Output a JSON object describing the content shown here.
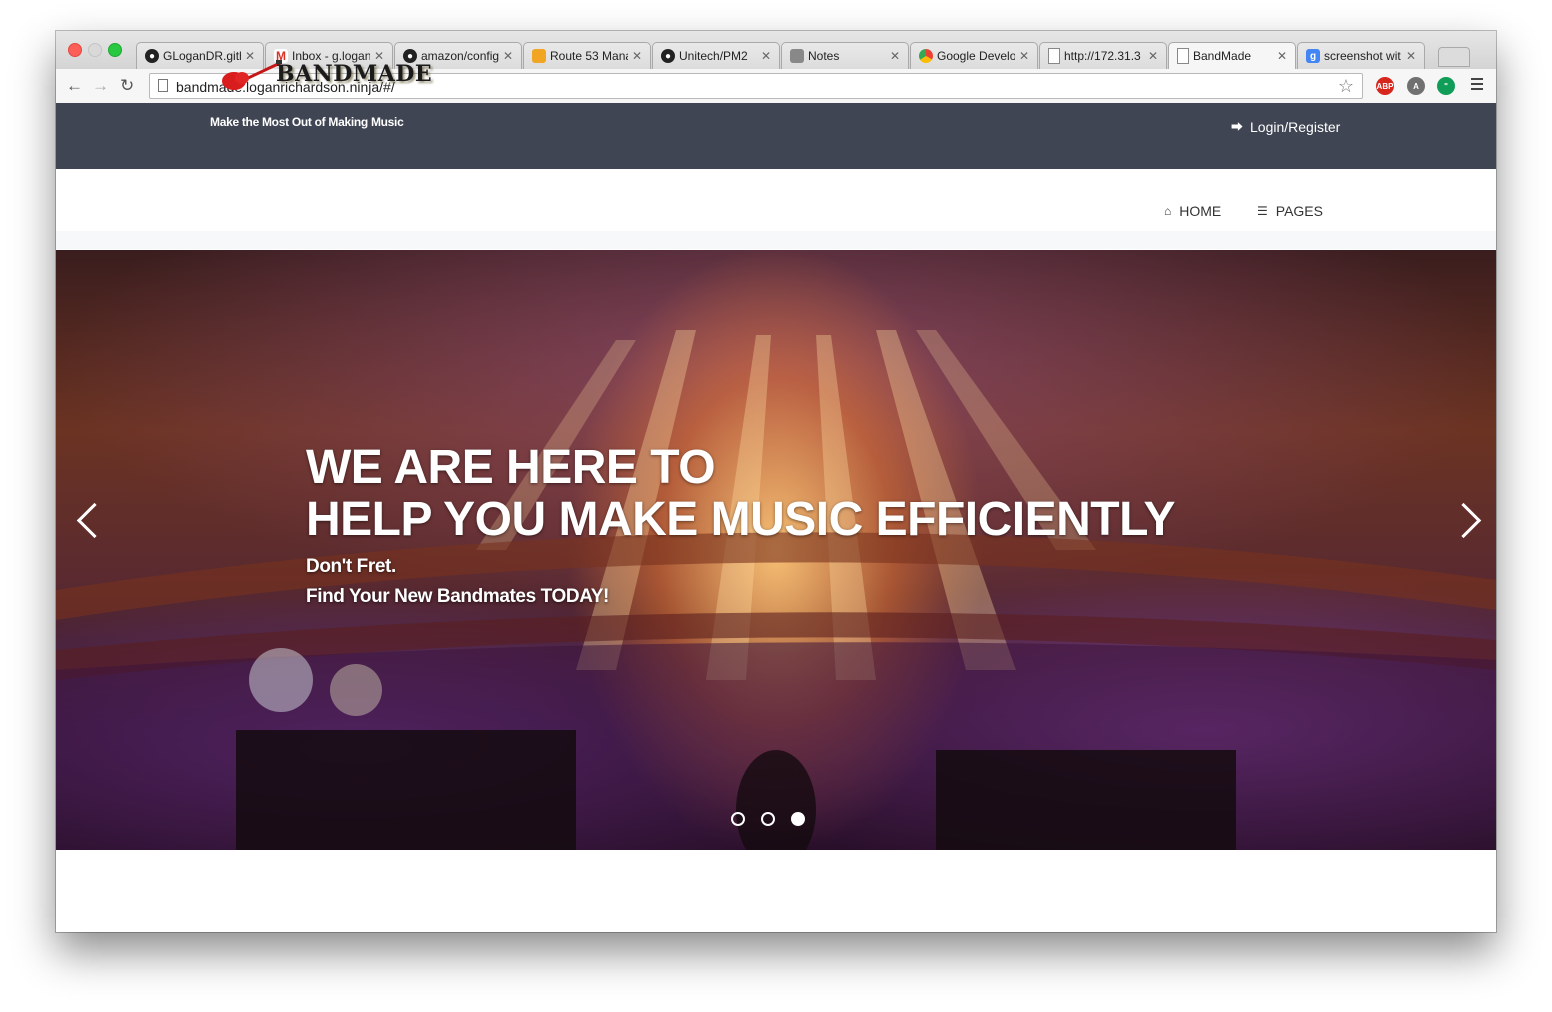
{
  "browser": {
    "tabs": [
      {
        "title": "GLoganDR.gith",
        "favicon": "github-icon"
      },
      {
        "title": "Inbox - g.logan",
        "favicon": "gmail-icon"
      },
      {
        "title": "amazon/config",
        "favicon": "github-icon"
      },
      {
        "title": "Route 53 Mana",
        "favicon": "aws-icon"
      },
      {
        "title": "Unitech/PM2",
        "favicon": "github-icon"
      },
      {
        "title": "Notes",
        "favicon": "notes-icon"
      },
      {
        "title": "Google Develo",
        "favicon": "chrome-icon"
      },
      {
        "title": "http://172.31.3",
        "favicon": "page-icon"
      },
      {
        "title": "BandMade",
        "favicon": "page-icon",
        "active": true
      },
      {
        "title": "screenshot wit",
        "favicon": "google-icon"
      }
    ],
    "url": "bandmade.loganrichardson.ninja/#/",
    "extensions": [
      "adblock-icon",
      "angular-icon",
      "hangouts-icon"
    ]
  },
  "site": {
    "tagline": "Make the Most Out of Making Music",
    "login_label": "Login/Register",
    "logo_text": "BANDMADE",
    "nav": {
      "home": "HOME",
      "pages": "PAGES"
    },
    "hero": {
      "line1": "WE ARE HERE TO",
      "line2": "HELP YOU MAKE MUSIC EFFICIENTLY",
      "sub1": "Don't Fret.",
      "sub2": "Find Your New Bandmates TODAY!",
      "slide_count": 3,
      "active_slide": 3
    }
  },
  "colors": {
    "topbar": "#3f4553",
    "accent_red": "#d91c1c"
  }
}
